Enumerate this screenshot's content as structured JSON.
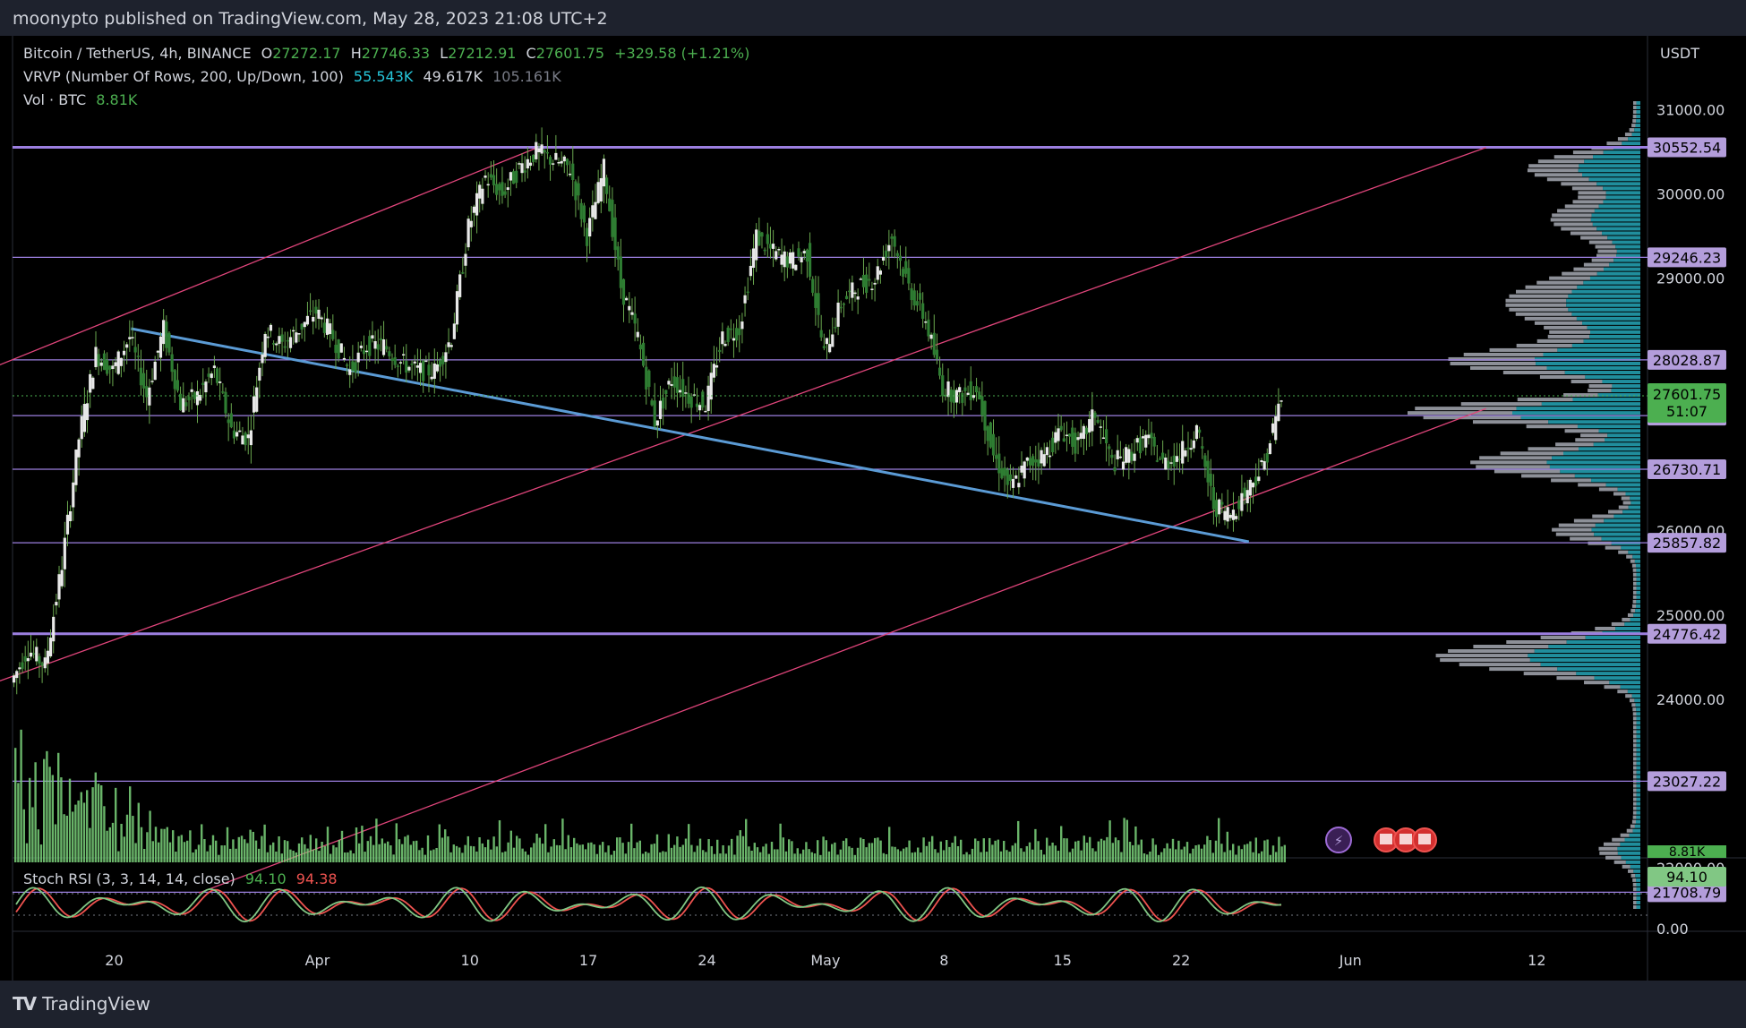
{
  "header": {
    "publisher_line": "moonypto published on TradingView.com, May 28, 2023 21:08 UTC+2"
  },
  "footer": {
    "brand": "TradingView",
    "logo_glyph": "TV"
  },
  "legend": {
    "symbol": "Bitcoin / TetherUS, 4h, BINANCE",
    "open_label": "O",
    "open": "27272.17",
    "high_label": "H",
    "high": "27746.33",
    "low_label": "L",
    "low": "27212.91",
    "close_label": "C",
    "close": "27601.75",
    "change": "+329.58 (+1.21%)",
    "vrvp_label": "VRVP (Number Of Rows, 200, Up/Down, 100)",
    "vrvp_up": "55.543K",
    "vrvp_down": "49.617K",
    "vrvp_total": "105.161K",
    "vol_label": "Vol · BTC",
    "vol_value": "8.81K",
    "stoch_label": "Stoch RSI (3, 3, 14, 14, close)",
    "stoch_k": "94.10",
    "stoch_d": "94.38"
  },
  "colors": {
    "background": "#000000",
    "candle": "#e8e8e8",
    "wick": "#6aa84f",
    "volume": "#7bd47b",
    "level_line": "#9c7fe0",
    "level_label": "#b39ddb",
    "trendline": "#5b9bd5",
    "channel": "#e0457b",
    "vrvp_up": "#26a7b8",
    "vrvp_down": "#b0b4be",
    "stoch_k": "#81c784",
    "stoch_d": "#ef5350",
    "last_price_label": "#4caf50"
  },
  "chart_data": {
    "type": "candlestick",
    "currency": "USDT",
    "timeframe": "4h",
    "xlim": [
      "2023-03-14",
      "2023-06-16"
    ],
    "ylim": [
      21500,
      31100
    ],
    "x_ticks": [
      "20",
      "Apr",
      "10",
      "17",
      "24",
      "May",
      "8",
      "15",
      "22",
      "Jun",
      "12"
    ],
    "y_ticks": [
      "31000.00",
      "30000.00",
      "29000.00",
      "26000.00",
      "25000.00",
      "24000.00",
      "22000.00"
    ],
    "y_tick_values": [
      31000,
      30000,
      29000,
      26000,
      25000,
      24000,
      22000
    ],
    "horizontal_levels": [
      {
        "value": 30552.54,
        "label": "30552.54"
      },
      {
        "value": 29246.23,
        "label": "29246.23"
      },
      {
        "value": 28028.87,
        "label": "28028.87"
      },
      {
        "value": 27366.94,
        "label": "27366.94"
      },
      {
        "value": 26730.71,
        "label": "26730.71"
      },
      {
        "value": 25857.82,
        "label": "25857.82"
      },
      {
        "value": 24776.42,
        "label": "24776.42"
      },
      {
        "value": 23027.22,
        "label": "23027.22"
      },
      {
        "value": 21708.79,
        "label": "21708.79"
      }
    ],
    "last_price": {
      "value": 27601.75,
      "label": "27601.75",
      "countdown": "51:07"
    },
    "trendline": [
      {
        "t": "2023-03-21",
        "y": 28400
      },
      {
        "t": "2023-05-26",
        "y": 25870
      }
    ],
    "channel_lines": [
      [
        {
          "t": "2023-03-13",
          "y": 27950
        },
        {
          "t": "2023-04-14",
          "y": 30550
        }
      ],
      [
        {
          "t": "2023-03-13",
          "y": 24200
        },
        {
          "t": "2023-06-09",
          "y": 30550
        }
      ],
      [
        {
          "t": "2023-03-25",
          "y": 21700
        },
        {
          "t": "2023-06-09",
          "y": 27450
        }
      ]
    ],
    "close_path": [
      {
        "t": "2023-03-14",
        "y": 24200
      },
      {
        "t": "2023-03-15",
        "y": 24600
      },
      {
        "t": "2023-03-16",
        "y": 24400
      },
      {
        "t": "2023-03-17",
        "y": 25600
      },
      {
        "t": "2023-03-18",
        "y": 27100
      },
      {
        "t": "2023-03-19",
        "y": 28100
      },
      {
        "t": "2023-03-20",
        "y": 27900
      },
      {
        "t": "2023-03-21",
        "y": 28300
      },
      {
        "t": "2023-03-22",
        "y": 27600
      },
      {
        "t": "2023-03-23",
        "y": 28400
      },
      {
        "t": "2023-03-24",
        "y": 27500
      },
      {
        "t": "2023-03-25",
        "y": 27600
      },
      {
        "t": "2023-03-26",
        "y": 27900
      },
      {
        "t": "2023-03-27",
        "y": 27200
      },
      {
        "t": "2023-03-28",
        "y": 27100
      },
      {
        "t": "2023-03-29",
        "y": 28400
      },
      {
        "t": "2023-03-30",
        "y": 28200
      },
      {
        "t": "2023-03-31",
        "y": 28400
      },
      {
        "t": "2023-04-01",
        "y": 28600
      },
      {
        "t": "2023-04-02",
        "y": 28300
      },
      {
        "t": "2023-04-03",
        "y": 27900
      },
      {
        "t": "2023-04-04",
        "y": 28200
      },
      {
        "t": "2023-04-05",
        "y": 28200
      },
      {
        "t": "2023-04-06",
        "y": 28000
      },
      {
        "t": "2023-04-07",
        "y": 27900
      },
      {
        "t": "2023-04-08",
        "y": 27900
      },
      {
        "t": "2023-04-09",
        "y": 28300
      },
      {
        "t": "2023-04-10",
        "y": 29600
      },
      {
        "t": "2023-04-11",
        "y": 30200
      },
      {
        "t": "2023-04-12",
        "y": 30000
      },
      {
        "t": "2023-04-13",
        "y": 30300
      },
      {
        "t": "2023-04-14",
        "y": 30500
      },
      {
        "t": "2023-04-15",
        "y": 30400
      },
      {
        "t": "2023-04-16",
        "y": 30300
      },
      {
        "t": "2023-04-17",
        "y": 29500
      },
      {
        "t": "2023-04-18",
        "y": 30300
      },
      {
        "t": "2023-04-19",
        "y": 28900
      },
      {
        "t": "2023-04-20",
        "y": 28300
      },
      {
        "t": "2023-04-21",
        "y": 27300
      },
      {
        "t": "2023-04-22",
        "y": 27800
      },
      {
        "t": "2023-04-23",
        "y": 27600
      },
      {
        "t": "2023-04-24",
        "y": 27500
      },
      {
        "t": "2023-04-25",
        "y": 28300
      },
      {
        "t": "2023-04-26",
        "y": 28400
      },
      {
        "t": "2023-04-27",
        "y": 29500
      },
      {
        "t": "2023-04-28",
        "y": 29300
      },
      {
        "t": "2023-04-29",
        "y": 29200
      },
      {
        "t": "2023-04-30",
        "y": 29300
      },
      {
        "t": "2023-05-01",
        "y": 28100
      },
      {
        "t": "2023-05-02",
        "y": 28700
      },
      {
        "t": "2023-05-03",
        "y": 28900
      },
      {
        "t": "2023-05-04",
        "y": 29000
      },
      {
        "t": "2023-05-05",
        "y": 29500
      },
      {
        "t": "2023-05-06",
        "y": 28900
      },
      {
        "t": "2023-05-07",
        "y": 28500
      },
      {
        "t": "2023-05-08",
        "y": 27700
      },
      {
        "t": "2023-05-09",
        "y": 27600
      },
      {
        "t": "2023-05-10",
        "y": 27700
      },
      {
        "t": "2023-05-11",
        "y": 26900
      },
      {
        "t": "2023-05-12",
        "y": 26500
      },
      {
        "t": "2023-05-13",
        "y": 26800
      },
      {
        "t": "2023-05-14",
        "y": 26900
      },
      {
        "t": "2023-05-15",
        "y": 27200
      },
      {
        "t": "2023-05-16",
        "y": 27000
      },
      {
        "t": "2023-05-17",
        "y": 27400
      },
      {
        "t": "2023-05-18",
        "y": 26800
      },
      {
        "t": "2023-05-19",
        "y": 26900
      },
      {
        "t": "2023-05-20",
        "y": 27100
      },
      {
        "t": "2023-05-21",
        "y": 26800
      },
      {
        "t": "2023-05-22",
        "y": 26900
      },
      {
        "t": "2023-05-23",
        "y": 27200
      },
      {
        "t": "2023-05-24",
        "y": 26300
      },
      {
        "t": "2023-05-25",
        "y": 26200
      },
      {
        "t": "2023-05-26",
        "y": 26500
      },
      {
        "t": "2023-05-27",
        "y": 26800
      },
      {
        "t": "2023-05-28",
        "y": 27600
      }
    ],
    "volume_profile": {
      "ylim": [
        21500,
        31100
      ],
      "max_width": 260
    },
    "stoch_rsi": {
      "ylim": [
        0,
        100
      ],
      "y_ticks": [
        "0.00"
      ],
      "k": 94.1,
      "d": 94.38,
      "levels": [
        80,
        20
      ]
    }
  },
  "axis": {
    "currency_label": "USDT",
    "volume_badge": "8.81K",
    "stoch_badge": "94.10"
  }
}
